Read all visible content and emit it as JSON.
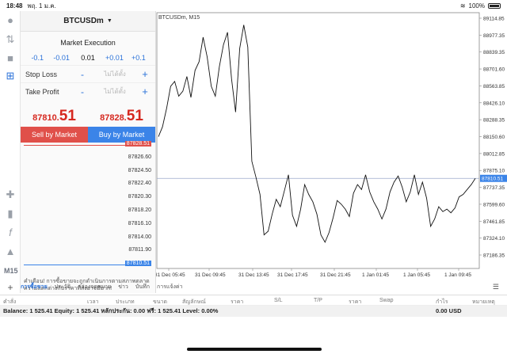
{
  "status": {
    "time": "18:48",
    "date": "พฤ. 1 ม.ค.",
    "battery": "100%"
  },
  "panel": {
    "symbol": "BTCUSDm",
    "execution": "Market Execution",
    "vol": {
      "m1": "-0.1",
      "m2": "-0.01",
      "value": "0.01",
      "p1": "+0.01",
      "p2": "+0.1"
    },
    "stop_loss": {
      "label": "Stop Loss",
      "minus": "-",
      "placeholder": "ไม่ได้ตั้ง",
      "plus": "+"
    },
    "take_profit": {
      "label": "Take Profit",
      "minus": "-",
      "placeholder": "ไม่ได้ตั้ง",
      "plus": "+"
    },
    "sell_price": {
      "main": "87810.",
      "big": "51"
    },
    "buy_price": {
      "main": "87828.",
      "big": "51"
    },
    "sell_button": "Sell by Market",
    "buy_button": "Buy by Market",
    "book_levels": [
      "87828.51",
      "87826.60",
      "87824.50",
      "87822.40",
      "87820.30",
      "87818.20",
      "87816.10",
      "87814.00",
      "87811.90",
      "87810.51"
    ],
    "warning": "คำเตือน! การซื้อขายจะถูกดำเนินการตามสภาพตลาด ความแตกต่างกับราคาที่ส่งอาจมีมาก!"
  },
  "tools": {
    "m15": "M15",
    "plus": "+"
  },
  "chart_data": {
    "type": "line",
    "title": "BTCUSDm, M15",
    "y_ticks": [
      "89114.85",
      "88977.35",
      "88839.35",
      "88701.60",
      "88563.85",
      "88426.10",
      "88288.35",
      "88150.60",
      "88012.85",
      "87875.10",
      "87737.35",
      "87599.60",
      "87461.85",
      "87324.10",
      "87186.35"
    ],
    "x_ticks": [
      "31 Dec 05:45",
      "31 Dec 09:45",
      "31 Dec 13:45",
      "31 Dec 17:45",
      "31 Dec 21:45",
      "1 Jan 01:45",
      "1 Jan 05:45",
      "1 Jan 09:45"
    ],
    "current_price": "87810.51",
    "ylim": [
      87186.35,
      89114.85
    ],
    "series": [
      {
        "values": [
          88150,
          88230,
          88380,
          88560,
          88600,
          88480,
          88520,
          88640,
          88470,
          88690,
          88760,
          88960,
          88800,
          88560,
          88480,
          88720,
          88900,
          89000,
          88620,
          88350,
          88870,
          89060,
          88880,
          87950,
          87820,
          87680,
          87350,
          87380,
          87520,
          87640,
          87580,
          87710,
          87840,
          87510,
          87420,
          87560,
          87760,
          87680,
          87620,
          87520,
          87350,
          87290,
          87370,
          87490,
          87630,
          87600,
          87560,
          87500,
          87690,
          87760,
          87720,
          87840,
          87700,
          87620,
          87560,
          87480,
          87560,
          87700,
          87780,
          87830,
          87740,
          87620,
          87700,
          87840,
          87680,
          87780,
          87650,
          87420,
          87480,
          87580,
          87540,
          87560,
          87530,
          87570,
          87660,
          87680,
          87720,
          87760,
          87810
        ]
      }
    ]
  },
  "bottom": {
    "plus": "+",
    "tabs": [
      "การซื้อขาย",
      "ประวัติ",
      "กล่องจดหมาย",
      "ข่าว",
      "บันทึก",
      "การแจ้งค่า"
    ],
    "columns": [
      "คำสั่ง",
      "เวลา",
      "ประเภท",
      "ขนาด",
      "สัญลักษณ์",
      "ราคา",
      "S/L",
      "T/P",
      "ราคา",
      "Swap",
      "กำไร",
      "หมายเหตุ"
    ],
    "balance": "Balance: 1 525.41 Equity: 1 525.41 หลักประกัน: 0.00 ฟรี: 1 525.41 Level: 0.00%",
    "profit": "0.00  USD"
  },
  "colors": {
    "sell": "#e0504a",
    "buy": "#3b84e8",
    "accent": "#2b72d9"
  }
}
